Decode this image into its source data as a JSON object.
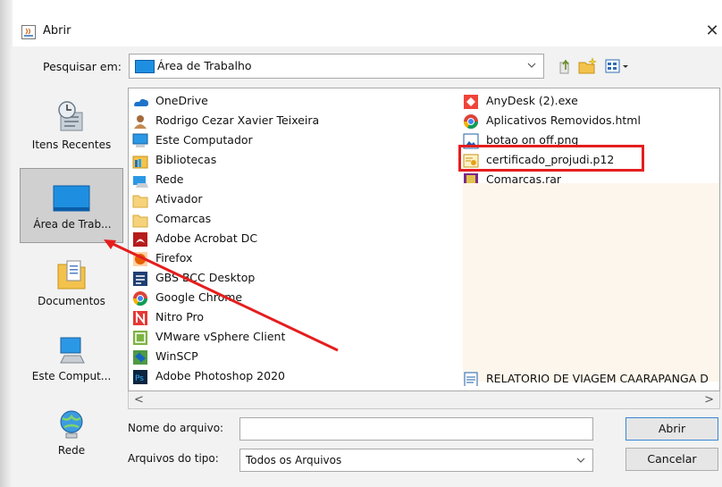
{
  "window": {
    "title": "Abrir",
    "close_glyph": "✕"
  },
  "lookin": {
    "label": "Pesquisar em:",
    "value": "Área de Trabalho"
  },
  "toolbar": {
    "icons": [
      "up-folder-icon",
      "new-folder-icon",
      "view-menu-icon"
    ]
  },
  "places": [
    {
      "label": "Itens Recentes",
      "icon": "recent-items-icon"
    },
    {
      "label": "Área de Trab...",
      "icon": "desktop-icon",
      "selected": true
    },
    {
      "label": "Documentos",
      "icon": "documents-icon"
    },
    {
      "label": "Este Comput...",
      "icon": "computer-icon"
    },
    {
      "label": "Rede",
      "icon": "network-icon"
    }
  ],
  "files_col1": [
    {
      "name": "OneDrive",
      "icon": "onedrive-icon"
    },
    {
      "name": "Rodrigo Cezar Xavier Teixeira",
      "icon": "user-folder-icon"
    },
    {
      "name": "Este Computador",
      "icon": "computer-icon"
    },
    {
      "name": "Bibliotecas",
      "icon": "libraries-icon"
    },
    {
      "name": "Rede",
      "icon": "network-icon"
    },
    {
      "name": "Ativador",
      "icon": "folder-icon"
    },
    {
      "name": "Comarcas",
      "icon": "folder-icon"
    },
    {
      "name": "Adobe Acrobat DC",
      "icon": "acrobat-icon"
    },
    {
      "name": "Firefox",
      "icon": "firefox-icon"
    },
    {
      "name": "GBS BCC Desktop",
      "icon": "gbs-icon"
    },
    {
      "name": "Google Chrome",
      "icon": "chrome-icon"
    },
    {
      "name": "Nitro Pro",
      "icon": "nitro-icon"
    },
    {
      "name": "VMware vSphere Client",
      "icon": "vmware-icon"
    },
    {
      "name": "WinSCP",
      "icon": "winscp-icon"
    },
    {
      "name": "Adobe Photoshop 2020",
      "icon": "photoshop-icon"
    }
  ],
  "files_col2": [
    {
      "name": "AnyDesk (2).exe",
      "icon": "anydesk-icon"
    },
    {
      "name": "Aplicativos Removidos.html",
      "icon": "chrome-icon"
    },
    {
      "name": "botao on off.png",
      "icon": "image-icon"
    },
    {
      "name": "certificado_projudi.p12",
      "icon": "certificate-icon"
    },
    {
      "name": "Comarcas.rar",
      "icon": "rar-icon"
    },
    {
      "name": "RELATORIO DE VIAGEM CAARAPANGA D",
      "icon": "document-icon"
    }
  ],
  "filename": {
    "label": "Nome do arquivo:",
    "value": ""
  },
  "filetype": {
    "label": "Arquivos do tipo:",
    "value": "Todos os Arquivos"
  },
  "buttons": {
    "open": "Abrir",
    "cancel": "Cancelar"
  },
  "colors": {
    "annotation": "#e51e1e",
    "accent": "#3b86d6",
    "highlight_bg": "#fdf6ec"
  }
}
